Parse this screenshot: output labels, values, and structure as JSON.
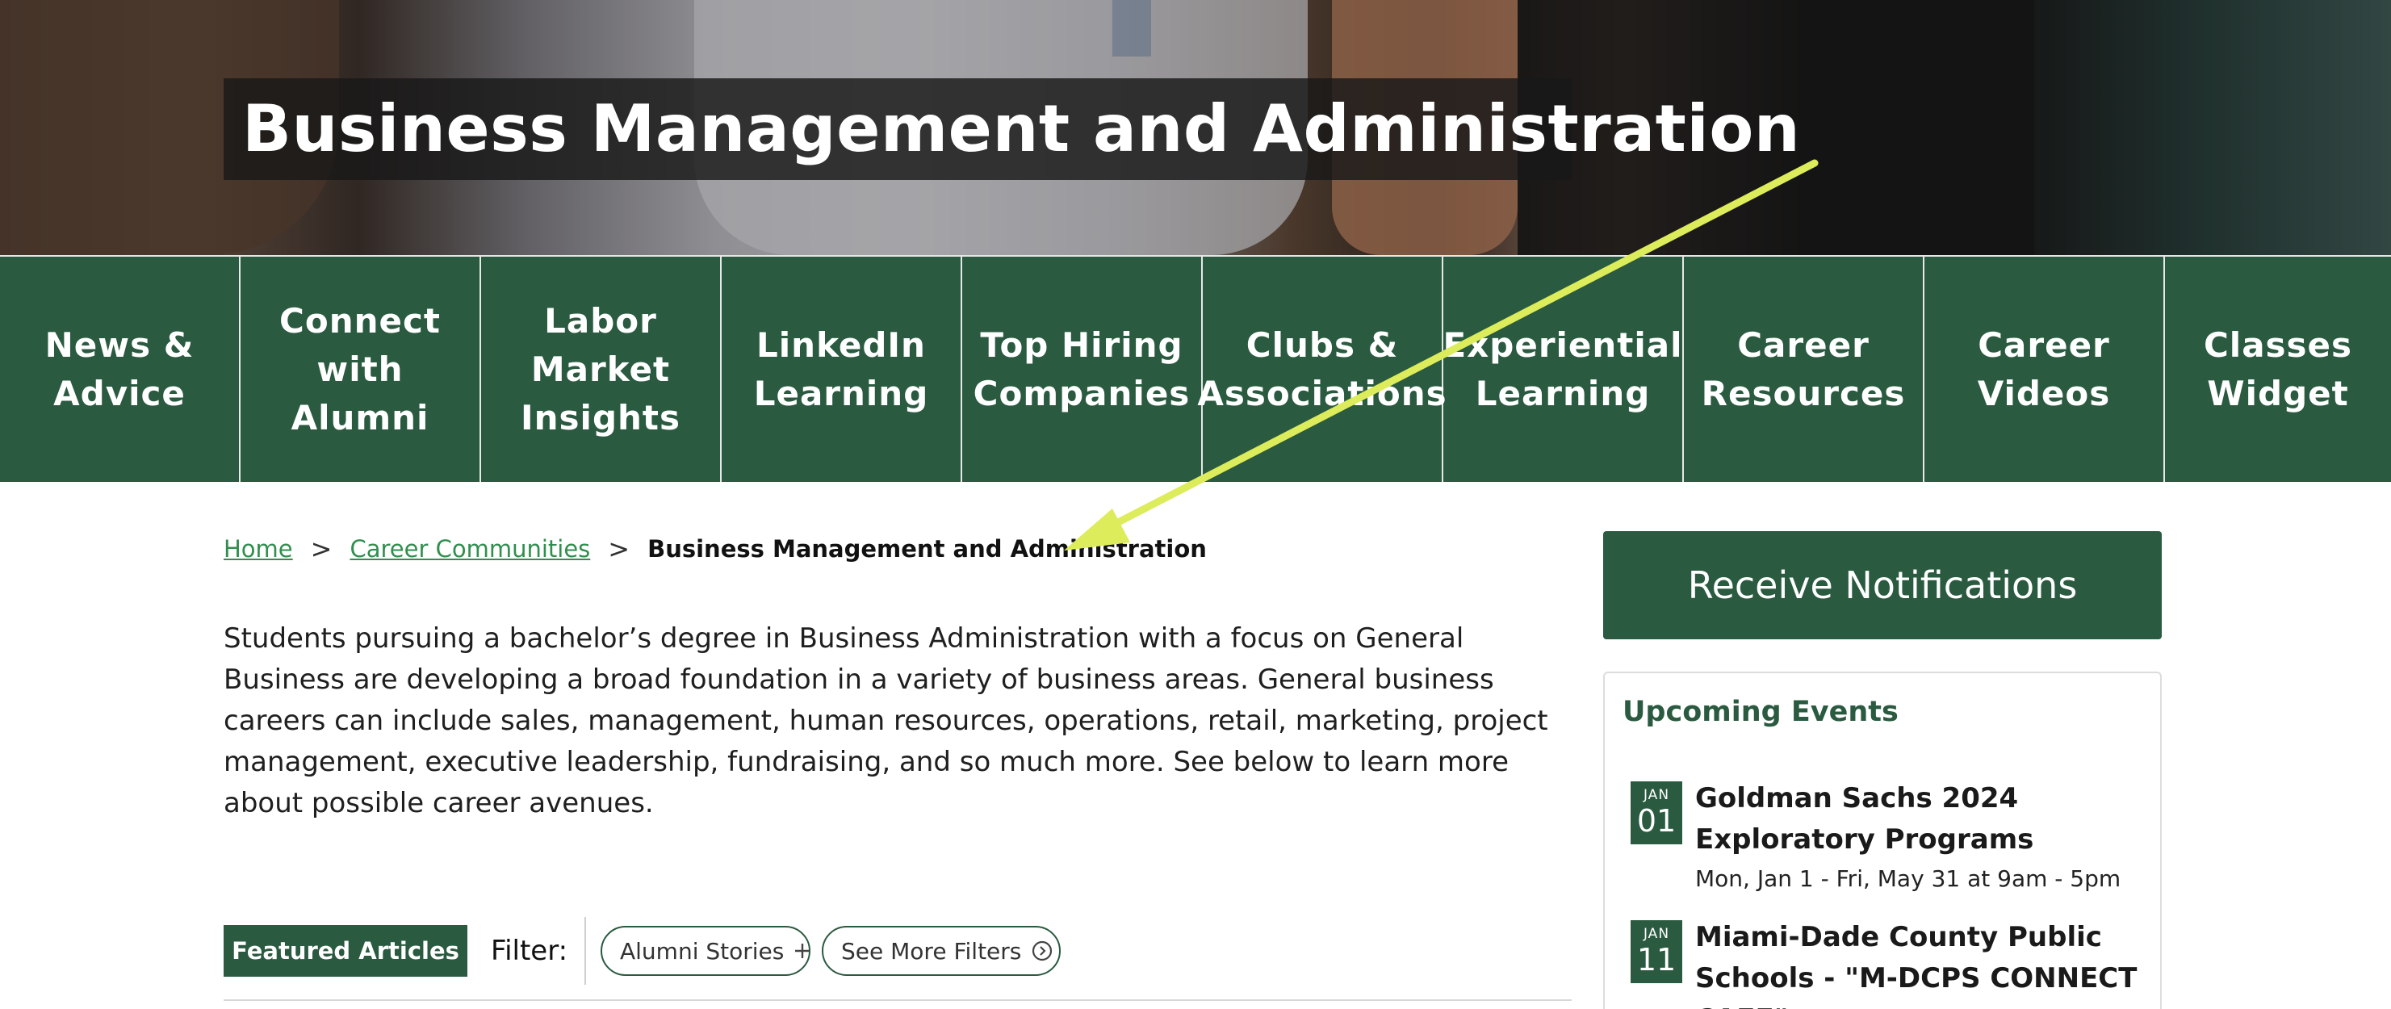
{
  "hero": {
    "title": "Business Management and Administration"
  },
  "nav": {
    "items": [
      {
        "label_line1": "News &",
        "label_line2": "Advice"
      },
      {
        "label_line1": "Connect",
        "label_line2": "with Alumni"
      },
      {
        "label_line1": "Labor",
        "label_line2": "Market",
        "label_line3": "Insights"
      },
      {
        "label_line1": "LinkedIn",
        "label_line2": "Learning"
      },
      {
        "label_line1": "Top Hiring",
        "label_line2": "Companies"
      },
      {
        "label_line1": "Clubs &",
        "label_line2": "Associations"
      },
      {
        "label_line1": "Experiential",
        "label_line2": "Learning"
      },
      {
        "label_line1": "Career",
        "label_line2": "Resources"
      },
      {
        "label_line1": "Career",
        "label_line2": "Videos"
      },
      {
        "label_line1": "Classes",
        "label_line2": "Widget"
      }
    ]
  },
  "breadcrumb": {
    "home": "Home",
    "section": "Career Communities",
    "current": "Business Management and Administration",
    "separator": ">"
  },
  "intro": {
    "text": "Students pursuing a bachelor’s degree in Business Administration with a focus on General Business are developing a broad foundation in a variety of business areas. General business careers can include sales, management, human resources, operations, retail, marketing, project management, executive leadership, fundraising, and so much more. See below to learn more about possible career avenues."
  },
  "filters": {
    "featured_label": "Featured Articles",
    "filter_label": "Filter:",
    "chips": [
      {
        "label": "Alumni Stories",
        "icon": "plus-icon"
      },
      {
        "label": "See More Filters",
        "icon": "circle-arrow-right-icon"
      }
    ]
  },
  "sidebar": {
    "notify_label": "Receive Notifications",
    "events_title": "Upcoming Events",
    "events": [
      {
        "month": "JAN",
        "day": "01",
        "title": "Goldman Sachs 2024 Exploratory Programs",
        "time": "Mon, Jan 1 - Fri, May 31 at 9am - 5pm"
      },
      {
        "month": "JAN",
        "day": "11",
        "title": "Miami-Dade County Public Schools - \"M-DCPS CONNECT CAFE\"",
        "time": ""
      }
    ]
  },
  "colors": {
    "brand_green": "#2a5a3f",
    "link_green": "#2f8f4e",
    "annotation_arrow": "#dcec5a"
  }
}
